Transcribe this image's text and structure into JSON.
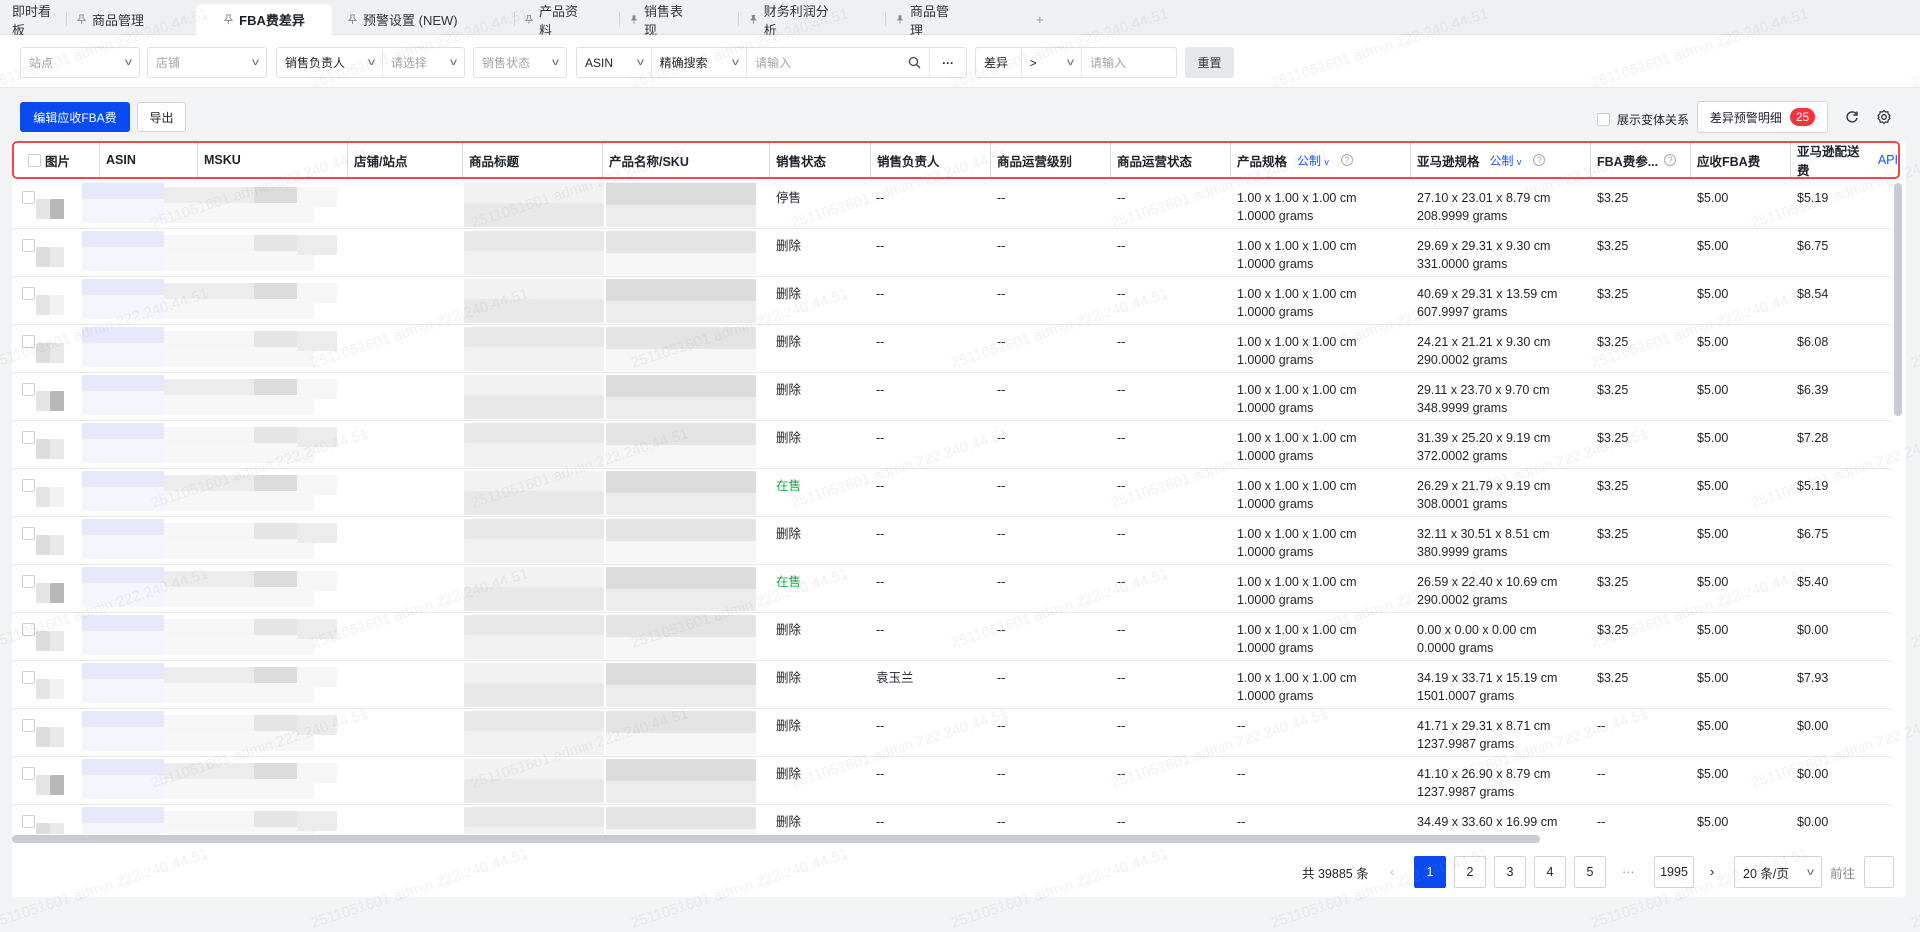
{
  "tabs": [
    {
      "label": "即时看板",
      "icon": "none"
    },
    {
      "label": "商品管理",
      "icon": "pin-outline-icon"
    },
    {
      "label": "FBA费差异",
      "icon": "pin-outline-icon",
      "active": true
    },
    {
      "label": "预警设置 (NEW)",
      "icon": "pin-outline-icon"
    },
    {
      "label": "产品资料",
      "icon": "pin-outline-icon"
    },
    {
      "label": "销售表现",
      "icon": "pin-filled-icon"
    },
    {
      "label": "财务利润分析",
      "icon": "pin-filled-icon"
    },
    {
      "label": "商品管理",
      "icon": "pin-filled-icon"
    }
  ],
  "add_tab": "+",
  "filters": {
    "site": "站点",
    "shop": "店铺",
    "owner_label": "销售负责人",
    "owner_placeholder": "请选择",
    "sale_status": "销售状态",
    "search_field": "ASIN",
    "search_mode": "精确搜索",
    "search_placeholder": "请输入",
    "more": "···",
    "diff_label": "差异",
    "diff_op": ">",
    "diff_placeholder": "请输入",
    "reset": "重置"
  },
  "toolbar": {
    "edit_fba": "编辑应收FBA费",
    "export": "导出",
    "show_variants": "展示变体关系",
    "diff_detail": "差异预警明细",
    "diff_count": "25"
  },
  "columns": {
    "image": "图片",
    "asin": "ASIN",
    "msku": "MSKU",
    "shop": "店铺/站点",
    "title": "商品标题",
    "pname": "产品名称/SKU",
    "status": "销售状态",
    "owner": "销售负责人",
    "level": "商品运营级别",
    "opstatus": "商品运营状态",
    "spec": "产品规格",
    "spec_unit": "公制",
    "amzspec": "亚马逊规格",
    "amzspec_unit": "公制",
    "fba": "FBA费参...",
    "recv": "应收FBA费",
    "amzfee": "亚马逊配送费",
    "api": "API"
  },
  "rows": [
    {
      "status": "停售",
      "owner": "--",
      "level": "--",
      "opstatus": "--",
      "spec": [
        "1.00 x 1.00 x 1.00 cm",
        "1.0000 grams"
      ],
      "amz": [
        "27.10 x 23.01 x 8.79 cm",
        "208.9999 grams"
      ],
      "fba": "$3.25",
      "recv": "$5.00",
      "fee": "$5.19"
    },
    {
      "status": "删除",
      "owner": "--",
      "level": "--",
      "opstatus": "--",
      "spec": [
        "1.00 x 1.00 x 1.00 cm",
        "1.0000 grams"
      ],
      "amz": [
        "29.69 x 29.31 x 9.30 cm",
        "331.0000 grams"
      ],
      "fba": "$3.25",
      "recv": "$5.00",
      "fee": "$6.75"
    },
    {
      "status": "删除",
      "owner": "--",
      "level": "--",
      "opstatus": "--",
      "spec": [
        "1.00 x 1.00 x 1.00 cm",
        "1.0000 grams"
      ],
      "amz": [
        "40.69 x 29.31 x 13.59 cm",
        "607.9997 grams"
      ],
      "fba": "$3.25",
      "recv": "$5.00",
      "fee": "$8.54"
    },
    {
      "status": "删除",
      "owner": "--",
      "level": "--",
      "opstatus": "--",
      "spec": [
        "1.00 x 1.00 x 1.00 cm",
        "1.0000 grams"
      ],
      "amz": [
        "24.21 x 21.21 x 9.30 cm",
        "290.0002 grams"
      ],
      "fba": "$3.25",
      "recv": "$5.00",
      "fee": "$6.08"
    },
    {
      "status": "删除",
      "owner": "--",
      "level": "--",
      "opstatus": "--",
      "spec": [
        "1.00 x 1.00 x 1.00 cm",
        "1.0000 grams"
      ],
      "amz": [
        "29.11 x 23.70 x 9.70 cm",
        "348.9999 grams"
      ],
      "fba": "$3.25",
      "recv": "$5.00",
      "fee": "$6.39"
    },
    {
      "status": "删除",
      "owner": "--",
      "level": "--",
      "opstatus": "--",
      "spec": [
        "1.00 x 1.00 x 1.00 cm",
        "1.0000 grams"
      ],
      "amz": [
        "31.39 x 25.20 x 9.19 cm",
        "372.0002 grams"
      ],
      "fba": "$3.25",
      "recv": "$5.00",
      "fee": "$7.28"
    },
    {
      "status": "在售",
      "owner": "--",
      "level": "--",
      "opstatus": "--",
      "spec": [
        "1.00 x 1.00 x 1.00 cm",
        "1.0000 grams"
      ],
      "amz": [
        "26.29 x 21.79 x 9.19 cm",
        "308.0001 grams"
      ],
      "fba": "$3.25",
      "recv": "$5.00",
      "fee": "$5.19"
    },
    {
      "status": "删除",
      "owner": "--",
      "level": "--",
      "opstatus": "--",
      "spec": [
        "1.00 x 1.00 x 1.00 cm",
        "1.0000 grams"
      ],
      "amz": [
        "32.11 x 30.51 x 8.51 cm",
        "380.9999 grams"
      ],
      "fba": "$3.25",
      "recv": "$5.00",
      "fee": "$6.75"
    },
    {
      "status": "在售",
      "owner": "--",
      "level": "--",
      "opstatus": "--",
      "spec": [
        "1.00 x 1.00 x 1.00 cm",
        "1.0000 grams"
      ],
      "amz": [
        "26.59 x 22.40 x 10.69 cm",
        "290.0002 grams"
      ],
      "fba": "$3.25",
      "recv": "$5.00",
      "fee": "$5.40"
    },
    {
      "status": "删除",
      "owner": "--",
      "level": "--",
      "opstatus": "--",
      "spec": [
        "1.00 x 1.00 x 1.00 cm",
        "1.0000 grams"
      ],
      "amz": [
        "0.00 x 0.00 x 0.00 cm",
        "0.0000 grams"
      ],
      "fba": "$3.25",
      "recv": "$5.00",
      "fee": "$0.00"
    },
    {
      "status": "删除",
      "owner": "袁玉兰",
      "level": "--",
      "opstatus": "--",
      "spec": [
        "1.00 x 1.00 x 1.00 cm",
        "1.0000 grams"
      ],
      "amz": [
        "34.19 x 33.71 x 15.19 cm",
        "1501.0007 grams"
      ],
      "fba": "$3.25",
      "recv": "$5.00",
      "fee": "$7.93"
    },
    {
      "status": "删除",
      "owner": "--",
      "level": "--",
      "opstatus": "--",
      "spec": [
        "--",
        ""
      ],
      "amz": [
        "41.71 x 29.31 x 8.71 cm",
        "1237.9987 grams"
      ],
      "fba": "--",
      "recv": "$5.00",
      "fee": "$0.00"
    },
    {
      "status": "删除",
      "owner": "--",
      "level": "--",
      "opstatus": "--",
      "spec": [
        "--",
        ""
      ],
      "amz": [
        "41.10 x 26.90 x 8.79 cm",
        "1237.9987 grams"
      ],
      "fba": "--",
      "recv": "$5.00",
      "fee": "$0.00"
    },
    {
      "status": "删除",
      "owner": "--",
      "level": "--",
      "opstatus": "--",
      "spec": [
        "--",
        ""
      ],
      "amz": [
        "34.49 x 33.60 x 16.99 cm",
        ""
      ],
      "fba": "--",
      "recv": "$5.00",
      "fee": "$0.00"
    }
  ],
  "colors": {
    "accent": "#0a4bf0",
    "on_sale": "#1aa34a",
    "badge": "#f5333f",
    "highlight": "#f04848"
  },
  "pagination": {
    "total": "共 39885 条",
    "prev": "‹",
    "pages": [
      "1",
      "2",
      "3",
      "4",
      "5"
    ],
    "ellipsis": "···",
    "last": "1995",
    "next": "›",
    "page_size": "20 条/页",
    "goto": "前往",
    "current": "1"
  },
  "watermark": "2511051601 admin 222.240.44.51"
}
